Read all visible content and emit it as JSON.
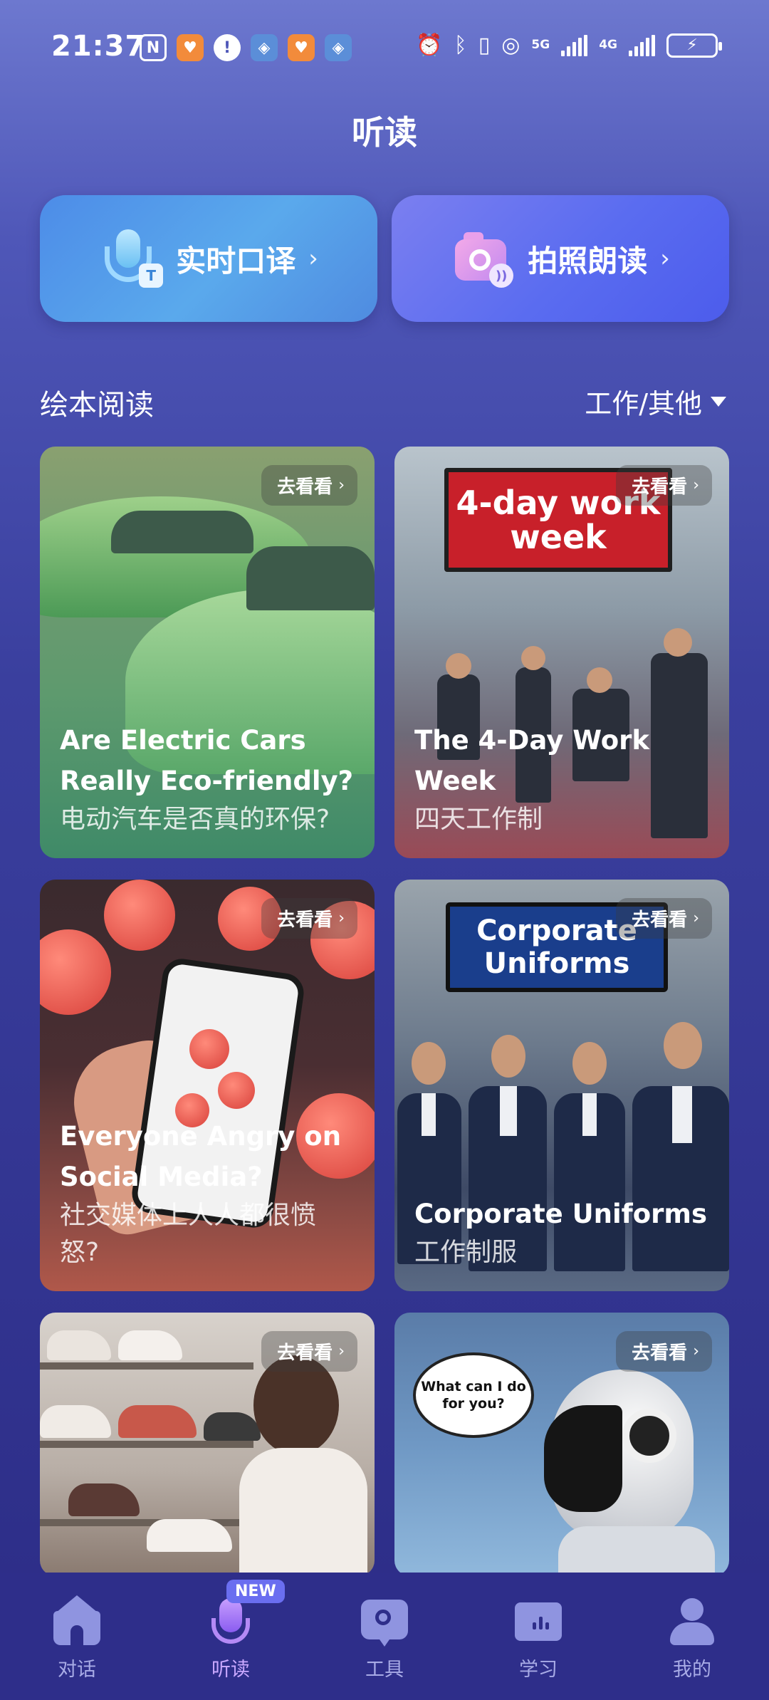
{
  "status_bar": {
    "time": "21:37",
    "left_icons": [
      "nfc-icon",
      "heart-app-icon",
      "info-circle-icon",
      "shield-app-icon",
      "heart-app-icon",
      "shield-app-icon"
    ],
    "network_1": "5G",
    "network_2": "4G",
    "right_icons": [
      "alarm-icon",
      "bluetooth-icon",
      "vibrate-icon",
      "hotspot-icon",
      "signal-icon",
      "battery-charging-icon"
    ]
  },
  "header": {
    "title": "听读"
  },
  "features": [
    {
      "label": "实时口译",
      "icon": "interpretation-mic-icon",
      "color": "#4d8ce8"
    },
    {
      "label": "拍照朗读",
      "icon": "photo-read-camera-icon",
      "color": "#6a72f0"
    }
  ],
  "section": {
    "title": "绘本阅读",
    "filter_label": "工作/其他"
  },
  "cards": [
    {
      "go_label": "去看看",
      "title_en": "Are Electric Cars Really Eco-friendly?",
      "title_zh": "电动汽车是否真的环保?"
    },
    {
      "go_label": "去看看",
      "title_en": "The 4-Day Work Week",
      "title_zh": "四天工作制",
      "image_text": "4-day work week"
    },
    {
      "go_label": "去看看",
      "title_en": "Everyone Angry on Social Media?",
      "title_zh": "社交媒体上人人都很愤怒?"
    },
    {
      "go_label": "去看看",
      "title_en": "Corporate Uniforms",
      "title_zh": "工作制服",
      "image_text": "Corporate Uniforms"
    },
    {
      "go_label": "去看看",
      "title_en": "",
      "title_zh": ""
    },
    {
      "go_label": "去看看",
      "title_en": "",
      "title_zh": "",
      "image_text": "What can I do for you?"
    }
  ],
  "bottom_nav": {
    "items": [
      {
        "label": "对话",
        "icon": "home-icon"
      },
      {
        "label": "听读",
        "icon": "microphone-icon",
        "active": true
      },
      {
        "label": "工具",
        "icon": "search-tool-icon"
      },
      {
        "label": "学习",
        "icon": "book-icon"
      },
      {
        "label": "我的",
        "icon": "user-icon"
      }
    ],
    "new_badge": "NEW"
  },
  "colors": {
    "accent": "#c9a8ff",
    "nav_bg": "#2e2e8a",
    "inactive": "#a8abe6"
  }
}
